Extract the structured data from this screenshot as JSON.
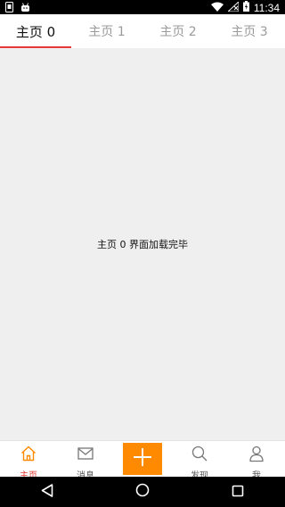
{
  "status_bar": {
    "time": "11:34",
    "icons": [
      "sim-icon",
      "android-icon",
      "wifi-icon",
      "no-signal-icon",
      "battery-icon"
    ]
  },
  "tabs": [
    {
      "label": "主页 0",
      "active": true
    },
    {
      "label": "主页 1",
      "active": false
    },
    {
      "label": "主页 2",
      "active": false
    },
    {
      "label": "主页 3",
      "active": false
    }
  ],
  "content": {
    "message": "主页 0 界面加载完毕"
  },
  "bottom_nav": {
    "items": [
      {
        "label": "主页",
        "icon": "home-icon",
        "active": true
      },
      {
        "label": "消息",
        "icon": "mail-icon",
        "active": false
      },
      {
        "label": "",
        "icon": "plus-icon",
        "active": false
      },
      {
        "label": "发现",
        "icon": "search-icon",
        "active": false
      },
      {
        "label": "我",
        "icon": "person-icon",
        "active": false
      }
    ]
  },
  "colors": {
    "accent": "#e53935",
    "add_button": "#ff8a00",
    "background": "#efefef"
  },
  "system_nav": {
    "icons": [
      "back-icon",
      "home-circle-icon",
      "recents-icon"
    ]
  }
}
